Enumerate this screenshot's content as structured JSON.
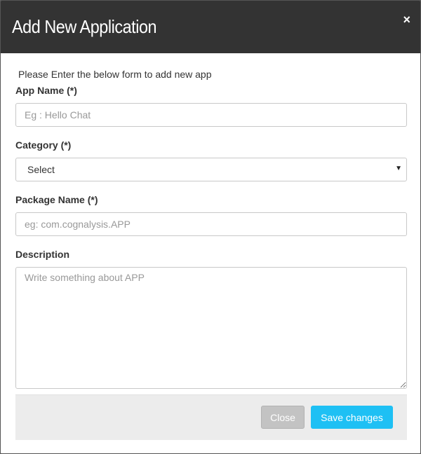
{
  "modal": {
    "title": "Add New Application",
    "close_icon": "×"
  },
  "form": {
    "intro": "Please Enter the below form to add new app",
    "app_name": {
      "label": "App Name (*)",
      "placeholder": "Eg : Hello Chat",
      "value": ""
    },
    "category": {
      "label": "Category (*)",
      "selected": "Select",
      "caret": "▼"
    },
    "package_name": {
      "label": "Package Name (*)",
      "placeholder": "eg: com.cognalysis.APP",
      "value": ""
    },
    "description": {
      "label": "Description",
      "placeholder": "Write something about APP",
      "value": ""
    }
  },
  "footer": {
    "close_label": "Close",
    "save_label": "Save changes"
  },
  "colors": {
    "header_bg": "#333333",
    "save_button": "#1ec0f4",
    "close_button": "#c3c3c3",
    "footer_bg": "#ececec"
  }
}
